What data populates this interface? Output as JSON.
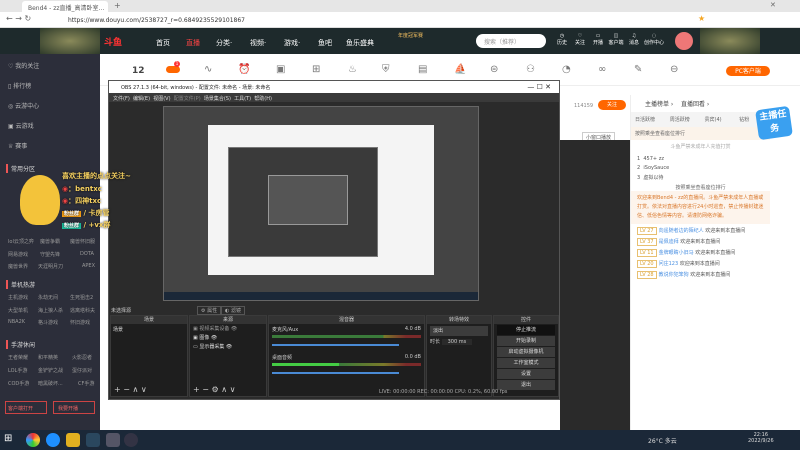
{
  "browser": {
    "tab_title": "Bend4 - zz直播_高清卧室...",
    "url": "https://www.douyu.com/2538727_r=0.6849235529101867"
  },
  "header": {
    "logo": "斗鱼",
    "nav": [
      "首页",
      "直播",
      "分类·",
      "视频·",
      "游戏·",
      "鱼吧",
      "鱼乐盛典"
    ],
    "event": "年度冠军赛",
    "search_placeholder": "搜索（推荐）",
    "icons": [
      "历史",
      "关注",
      "开播",
      "客户端",
      "消息",
      "创作中心"
    ]
  },
  "sidebar": {
    "items": [
      "我的关注",
      "排行榜",
      "云游中心",
      "云游戏",
      "赛事"
    ],
    "common": "常用分区",
    "all": "全部",
    "games1": [
      "lol云顶之弈",
      "魔兽争霸",
      "魔兽怀旧服",
      "网易游戏",
      "守望先锋",
      "DOTA",
      "魔兽世界",
      "天涯明月刀",
      "APEX"
    ],
    "single": "单机热游",
    "games2": [
      "主机游戏",
      "永劫无间",
      "生死狙击2",
      "大型单机",
      "海上狼人杀",
      "逃离塔科夫",
      "NBA2K",
      "格斗游戏",
      "怀旧游戏"
    ],
    "mobile": "手游休闲",
    "games3": [
      "王者荣耀",
      "和平精英",
      "火影忍者",
      "LOL手游",
      "金铲铲之战",
      "蛋仔派对",
      "COD手游",
      "暗黑破坏...",
      "CF手游"
    ],
    "btn_client": "客户端打开",
    "btn_live": "我要开播"
  },
  "toolbar": {
    "count": "12",
    "badge": "1",
    "pc": "PC客户端"
  },
  "obs": {
    "title": "OBS 27.1.3 (64-bit, windows) - 配置文件: 未命名 - 场景: 未命名",
    "menu": [
      "文件(F)",
      "编辑(E)",
      "视图(V)",
      "配置文件(P)",
      "场景集合(S)",
      "工具(T)",
      "帮助(H)"
    ],
    "no_source": "未选择源",
    "props": "属性",
    "filters": "滤镜",
    "docks": {
      "scenes": "场景",
      "sources": "来源",
      "mixer": "混音器",
      "transitions": "转场特效",
      "controls": "控件"
    },
    "scene_item": "场景",
    "sources": [
      "视频采集设备",
      "图像",
      "显示器采集"
    ],
    "mixer": [
      {
        "name": "麦克风/Aux",
        "db": "4.0 dB"
      },
      {
        "name": "桌面音频",
        "db": "0.0 dB"
      }
    ],
    "transition": "淡出",
    "duration_label": "时长",
    "duration": "300 ms",
    "controls": [
      "停止推流",
      "开始录制",
      "启动虚拟摄像机",
      "工作室模式",
      "设置",
      "退出"
    ],
    "status": "LIVE: 00:00:00   REC: 00:00:00   CPU: 0.2%, 60.00 fps"
  },
  "stream": {
    "followers": "114159",
    "follow": "关注",
    "mini": "小窗口播放"
  },
  "right": {
    "rank": "主播榜单",
    "review": "直播回看",
    "tabs": [
      "日活跃榜",
      "周活跃榜",
      "贵宾(4)",
      "钻粉"
    ],
    "rank_title": "按照乘坐查看座位排行",
    "notice": "斗鱼严禁未成年人充值打赏",
    "ranks": [
      {
        "n": "1",
        "name": "457+ zz"
      },
      {
        "n": "2",
        "name": "iSoySauce"
      },
      {
        "n": "3",
        "name": "虚拟以待"
      }
    ],
    "task": "主播任务",
    "welcome": "欢迎来到Bend4 - zz的直播间。斗鱼严禁未成年人直播或打赏。依法对直播内容进行24小时巡查，禁止传播封建迷信、低俗色情等内容。请谨防网络诈骗。",
    "chats": [
      {
        "lv": "LV 27",
        "user": "向遥随者边的陌纪人",
        "msg": "欢迎来到本直播间"
      },
      {
        "lv": "LV 37",
        "user": "是佩迪拜",
        "msg": "欢迎来到本直播间"
      },
      {
        "lv": "LV 11",
        "user": "金牌眼睛小旧马",
        "msg": "欢迎来到本直播间"
      },
      {
        "lv": "LV 20",
        "user": "问庄123",
        "msg": "欢迎来到本直播间"
      },
      {
        "lv": "LV 28",
        "user": "教说你犯笨狗",
        "msg": "欢迎来到本直播间"
      }
    ]
  },
  "overlay": {
    "line1": "喜欢主播的点点关注~",
    "weibo": "：bentxc",
    "douyin": "：四神txc",
    "fans": "粉丝群",
    "card": "卡房管",
    "vx": "+vx群"
  },
  "taskbar": {
    "weather": "26°C 多云",
    "time": "22:16",
    "date": "2022/9/26"
  }
}
